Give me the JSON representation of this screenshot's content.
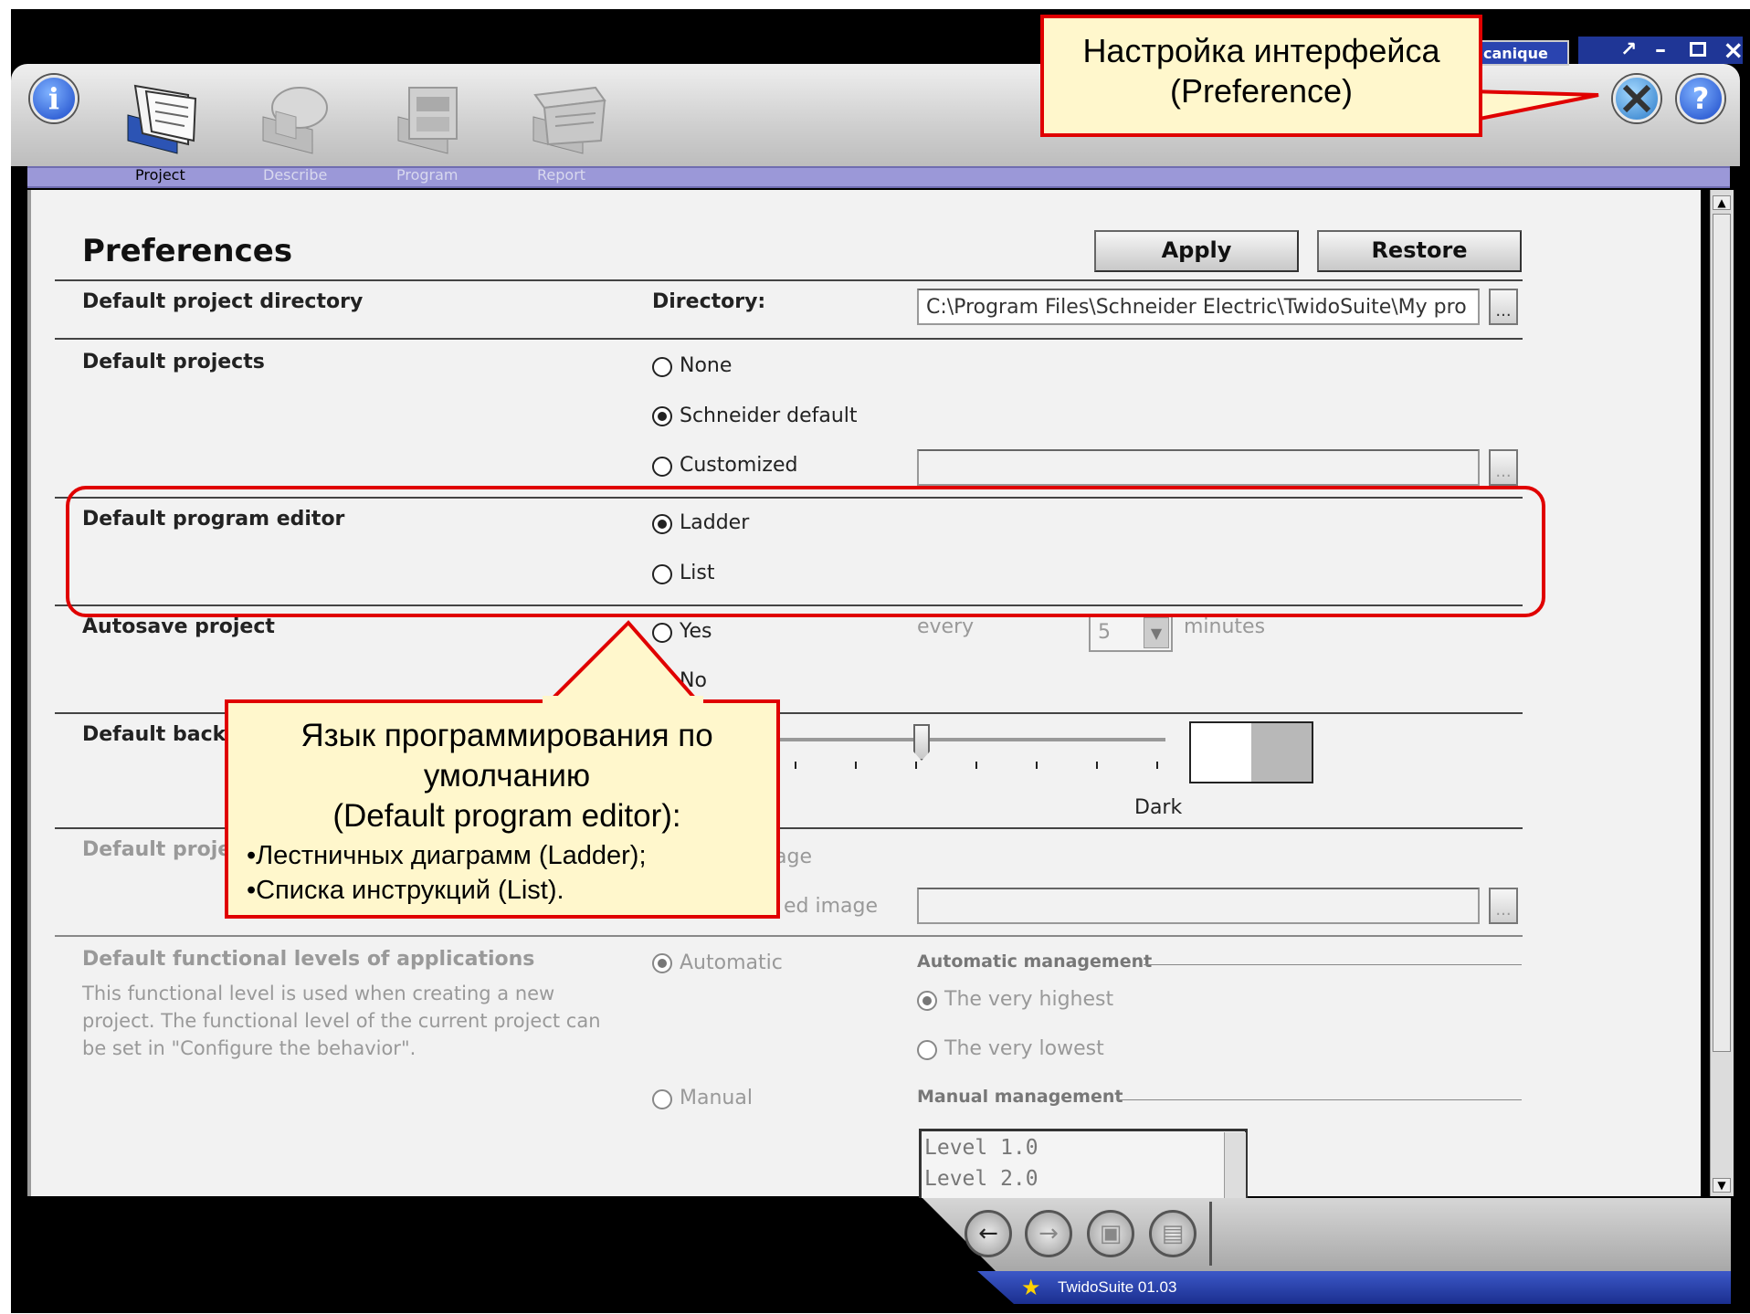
{
  "app": {
    "version_label": "TwidoSuite 01.03",
    "title_fragment": "canique"
  },
  "tabs": [
    {
      "label": "Project",
      "active": true
    },
    {
      "label": "Describe",
      "active": false
    },
    {
      "label": "Program",
      "active": false
    },
    {
      "label": "Report",
      "active": false
    }
  ],
  "page": {
    "title": "Preferences",
    "apply_label": "Apply",
    "restore_label": "Restore"
  },
  "sections": {
    "directory": {
      "label": "Default project directory",
      "field_label": "Directory:",
      "value": "C:\\Program Files\\Schneider Electric\\TwidoSuite\\My pro",
      "browse": "..."
    },
    "projects": {
      "label": "Default projects",
      "options": [
        "None",
        "Schneider default",
        "Customized"
      ],
      "selected": "Schneider default",
      "browse": "..."
    },
    "editor": {
      "label": "Default program editor",
      "options": [
        "Ladder",
        "List"
      ],
      "selected": "Ladder"
    },
    "autosave": {
      "label": "Autosave project",
      "options": [
        "Yes",
        "No"
      ],
      "every_label": "every",
      "interval_value": "5",
      "minutes_label": "minutes"
    },
    "background": {
      "label_visible": "Default back",
      "dark_label": "Dark",
      "slider_level": 0.43
    },
    "project_image": {
      "label_visible": "Default proje",
      "opt1_fragment": "age",
      "opt2_fragment": "ed image",
      "browse": "..."
    },
    "functional": {
      "label": "Default functional levels of applications",
      "description": "This functional level is used when creating a new project. The functional level of the current project can be set in \"Configure the behavior\".",
      "description_lines": [
        "This functional level is used when creating a new",
        "project. The functional level of the current project can",
        "be set in \"Configure the behavior\"."
      ],
      "automatic_label": "Automatic",
      "automatic_management": "Automatic management",
      "very_highest": "The very highest",
      "very_lowest": "The very lowest",
      "manual_label": "Manual",
      "manual_management": "Manual management",
      "levels": [
        "Level 1.0",
        "Level 2.0"
      ]
    }
  },
  "callouts": {
    "preference": {
      "line1": "Настройка интерфейса",
      "line2": "(Preference)"
    },
    "editor": {
      "line1": "Язык программирования по",
      "line2": "умолчанию",
      "line3": "(Default program editor):",
      "bullet1": "•Лестничных диаграмм (Ladder);",
      "bullet2": "•Списка инструкций (List)."
    }
  },
  "window_controls": {
    "pin": "↗",
    "minimize": "–",
    "restore": "🗗",
    "close": "×"
  },
  "colors": {
    "menu_strip": "#9b98d8",
    "callout_border": "#e00000",
    "callout_fill": "#fff7cc",
    "status_bar": "#2a44b0"
  }
}
